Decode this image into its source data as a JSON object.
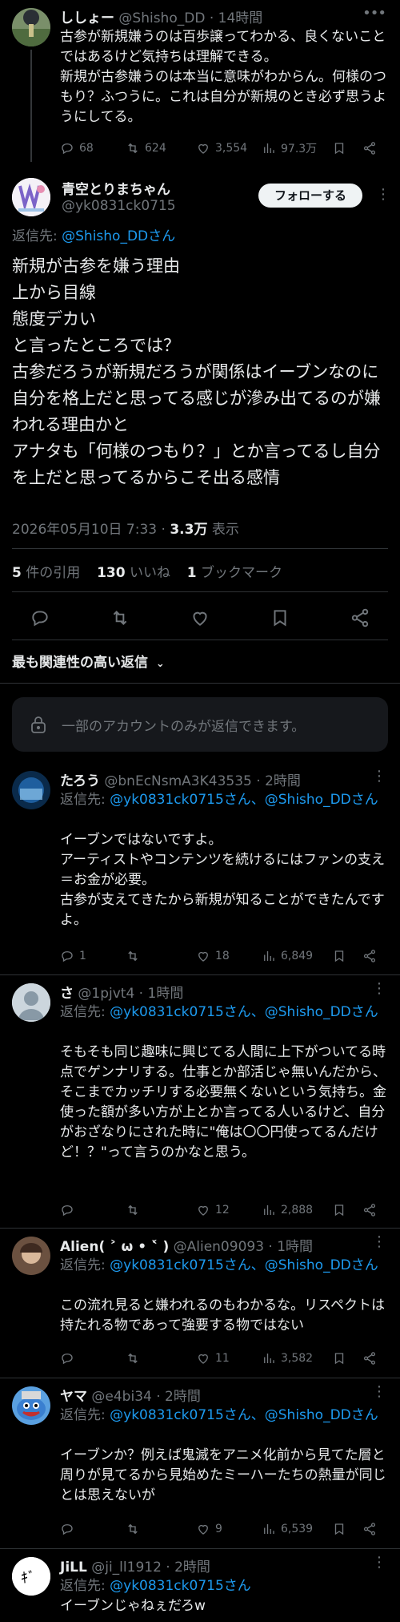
{
  "parent": {
    "name": "ししょー",
    "handle": "@Shisho_DD",
    "time": "14時間",
    "text": "古参が新規嫌うのは百歩譲ってわかる、良くないことではあるけど気持ちは理解できる。\n新規が古参嫌うのは本当に意味がわからん。何様のつもり？ふつうに。これは自分が新規のとき必ず思うようにしてる。",
    "replies": "68",
    "retweets": "624",
    "likes": "3,554",
    "views": "97.3万"
  },
  "main": {
    "name": "青空とりまちゃん",
    "handle": "@yk0831ck0715",
    "follow_label": "フォローする",
    "reply_to_prefix": "返信先: ",
    "reply_to": "@Shisho_DDさん",
    "text": "新規が古参を嫌う理由\n上から目線\n態度デカい\nと言ったところでは？\n古参だろうが新規だろうが関係はイーブンなのに自分を格上だと思ってる感じが滲み出てるのが嫌われる理由かと\nアナタも「何様のつもり？」とか言ってるし自分を上だと思ってるからこそ出る感情",
    "date": "2026年05月10日 7:33 · ",
    "views_count": "3.3万",
    "views_label": " 表示",
    "quotes_count": "5",
    "quotes_label": " 件の引用",
    "likes_count": "130",
    "likes_label": " いいね",
    "bookmarks_count": "1",
    "bookmarks_label": " ブックマーク"
  },
  "sort_label": "最も関連性の高い返信",
  "restricted_notice": "一部のアカウントのみが返信できます。",
  "replies": [
    {
      "name": "たろう",
      "handle": "@bnEcNsmA3K43535",
      "time": "2時間",
      "reply_to_prefix": "返信先: ",
      "reply_to": "@yk0831ck0715さん、@Shisho_DDさん",
      "text": "イーブンではないですよ。\nアーティストやコンテンツを続けるにはファンの支え＝お金が必要。\n古参が支えてきたから新規が知ることができたんですよ。",
      "replies": "1",
      "retweets": "",
      "likes": "18",
      "views": "6,849"
    },
    {
      "name": "さ",
      "handle": "@1pjvt4",
      "time": "1時間",
      "reply_to_prefix": "返信先: ",
      "reply_to": "@yk0831ck0715さん、@Shisho_DDさん",
      "text": "そもそも同じ趣味に興じてる人間に上下がついてる時点でゲンナリする。仕事とか部活じゃ無いんだから、そこまでカッチリする必要無くないという気持ち。金使った額が多い方が上とか言ってる人いるけど、自分がおざなりにされた時に\"俺は〇〇円使ってるんだけど！？\"って言うのかなと思う。",
      "replies": "",
      "retweets": "",
      "likes": "12",
      "views": "2,888"
    },
    {
      "name": "Alien( ˃ ω • ˂̀ )",
      "handle": "@Alien09093",
      "time": "1時間",
      "reply_to_prefix": "返信先: ",
      "reply_to": "@yk0831ck0715さん、@Shisho_DDさん",
      "text": "この流れ見ると嫌われるのもわかるな。リスペクトは持たれる物であって強要する物ではない",
      "replies": "",
      "retweets": "",
      "likes": "11",
      "views": "3,582"
    },
    {
      "name": "ヤマ",
      "handle": "@e4bi34",
      "time": "2時間",
      "reply_to_prefix": "返信先: ",
      "reply_to": "@yk0831ck0715さん、@Shisho_DDさん",
      "text": "イーブンか？例えば鬼滅をアニメ化前から見てた層と周りが見てるから見始めたミーハーたちの熱量が同じとは思えないが",
      "replies": "",
      "retweets": "",
      "likes": "9",
      "views": "6,539"
    },
    {
      "name": "JiLL",
      "handle": "@ji_ll1912",
      "time": "2時間",
      "reply_to_prefix": "返信先: ",
      "reply_to": "@yk0831ck0715さん",
      "text": "イーブンじゃねぇだろw"
    }
  ],
  "sep": " · ",
  "colors": {
    "bg": "#000000",
    "text": "#e7e9ea",
    "muted": "#71767b",
    "link": "#1d9bf0",
    "border": "#2f3336"
  }
}
